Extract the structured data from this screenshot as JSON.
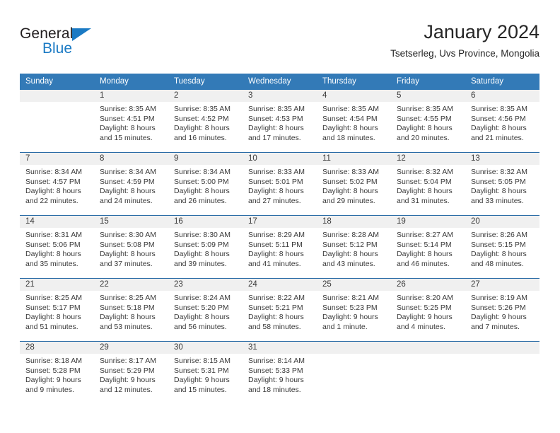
{
  "brand": {
    "name_part1": "General",
    "name_part2": "Blue",
    "accent_color": "#1a7ac4",
    "triangle_icon": "blue-triangle-icon"
  },
  "header": {
    "title": "January 2024",
    "subtitle": "Tsetserleg, Uvs Province, Mongolia"
  },
  "calendar": {
    "header_bg": "#337ab7",
    "header_text_color": "#ffffff",
    "row_separator_color": "#2a6ca6",
    "day_band_bg": "#f0f0f0",
    "weekdays": [
      "Sunday",
      "Monday",
      "Tuesday",
      "Wednesday",
      "Thursday",
      "Friday",
      "Saturday"
    ],
    "weeks": [
      [
        {
          "day": "",
          "sunrise": "",
          "sunset": "",
          "daylight_line1": "",
          "daylight_line2": "",
          "empty": true
        },
        {
          "day": "1",
          "sunrise": "Sunrise: 8:35 AM",
          "sunset": "Sunset: 4:51 PM",
          "daylight_line1": "Daylight: 8 hours",
          "daylight_line2": "and 15 minutes.",
          "empty": false
        },
        {
          "day": "2",
          "sunrise": "Sunrise: 8:35 AM",
          "sunset": "Sunset: 4:52 PM",
          "daylight_line1": "Daylight: 8 hours",
          "daylight_line2": "and 16 minutes.",
          "empty": false
        },
        {
          "day": "3",
          "sunrise": "Sunrise: 8:35 AM",
          "sunset": "Sunset: 4:53 PM",
          "daylight_line1": "Daylight: 8 hours",
          "daylight_line2": "and 17 minutes.",
          "empty": false
        },
        {
          "day": "4",
          "sunrise": "Sunrise: 8:35 AM",
          "sunset": "Sunset: 4:54 PM",
          "daylight_line1": "Daylight: 8 hours",
          "daylight_line2": "and 18 minutes.",
          "empty": false
        },
        {
          "day": "5",
          "sunrise": "Sunrise: 8:35 AM",
          "sunset": "Sunset: 4:55 PM",
          "daylight_line1": "Daylight: 8 hours",
          "daylight_line2": "and 20 minutes.",
          "empty": false
        },
        {
          "day": "6",
          "sunrise": "Sunrise: 8:35 AM",
          "sunset": "Sunset: 4:56 PM",
          "daylight_line1": "Daylight: 8 hours",
          "daylight_line2": "and 21 minutes.",
          "empty": false
        }
      ],
      [
        {
          "day": "7",
          "sunrise": "Sunrise: 8:34 AM",
          "sunset": "Sunset: 4:57 PM",
          "daylight_line1": "Daylight: 8 hours",
          "daylight_line2": "and 22 minutes.",
          "empty": false
        },
        {
          "day": "8",
          "sunrise": "Sunrise: 8:34 AM",
          "sunset": "Sunset: 4:59 PM",
          "daylight_line1": "Daylight: 8 hours",
          "daylight_line2": "and 24 minutes.",
          "empty": false
        },
        {
          "day": "9",
          "sunrise": "Sunrise: 8:34 AM",
          "sunset": "Sunset: 5:00 PM",
          "daylight_line1": "Daylight: 8 hours",
          "daylight_line2": "and 26 minutes.",
          "empty": false
        },
        {
          "day": "10",
          "sunrise": "Sunrise: 8:33 AM",
          "sunset": "Sunset: 5:01 PM",
          "daylight_line1": "Daylight: 8 hours",
          "daylight_line2": "and 27 minutes.",
          "empty": false
        },
        {
          "day": "11",
          "sunrise": "Sunrise: 8:33 AM",
          "sunset": "Sunset: 5:02 PM",
          "daylight_line1": "Daylight: 8 hours",
          "daylight_line2": "and 29 minutes.",
          "empty": false
        },
        {
          "day": "12",
          "sunrise": "Sunrise: 8:32 AM",
          "sunset": "Sunset: 5:04 PM",
          "daylight_line1": "Daylight: 8 hours",
          "daylight_line2": "and 31 minutes.",
          "empty": false
        },
        {
          "day": "13",
          "sunrise": "Sunrise: 8:32 AM",
          "sunset": "Sunset: 5:05 PM",
          "daylight_line1": "Daylight: 8 hours",
          "daylight_line2": "and 33 minutes.",
          "empty": false
        }
      ],
      [
        {
          "day": "14",
          "sunrise": "Sunrise: 8:31 AM",
          "sunset": "Sunset: 5:06 PM",
          "daylight_line1": "Daylight: 8 hours",
          "daylight_line2": "and 35 minutes.",
          "empty": false
        },
        {
          "day": "15",
          "sunrise": "Sunrise: 8:30 AM",
          "sunset": "Sunset: 5:08 PM",
          "daylight_line1": "Daylight: 8 hours",
          "daylight_line2": "and 37 minutes.",
          "empty": false
        },
        {
          "day": "16",
          "sunrise": "Sunrise: 8:30 AM",
          "sunset": "Sunset: 5:09 PM",
          "daylight_line1": "Daylight: 8 hours",
          "daylight_line2": "and 39 minutes.",
          "empty": false
        },
        {
          "day": "17",
          "sunrise": "Sunrise: 8:29 AM",
          "sunset": "Sunset: 5:11 PM",
          "daylight_line1": "Daylight: 8 hours",
          "daylight_line2": "and 41 minutes.",
          "empty": false
        },
        {
          "day": "18",
          "sunrise": "Sunrise: 8:28 AM",
          "sunset": "Sunset: 5:12 PM",
          "daylight_line1": "Daylight: 8 hours",
          "daylight_line2": "and 43 minutes.",
          "empty": false
        },
        {
          "day": "19",
          "sunrise": "Sunrise: 8:27 AM",
          "sunset": "Sunset: 5:14 PM",
          "daylight_line1": "Daylight: 8 hours",
          "daylight_line2": "and 46 minutes.",
          "empty": false
        },
        {
          "day": "20",
          "sunrise": "Sunrise: 8:26 AM",
          "sunset": "Sunset: 5:15 PM",
          "daylight_line1": "Daylight: 8 hours",
          "daylight_line2": "and 48 minutes.",
          "empty": false
        }
      ],
      [
        {
          "day": "21",
          "sunrise": "Sunrise: 8:25 AM",
          "sunset": "Sunset: 5:17 PM",
          "daylight_line1": "Daylight: 8 hours",
          "daylight_line2": "and 51 minutes.",
          "empty": false
        },
        {
          "day": "22",
          "sunrise": "Sunrise: 8:25 AM",
          "sunset": "Sunset: 5:18 PM",
          "daylight_line1": "Daylight: 8 hours",
          "daylight_line2": "and 53 minutes.",
          "empty": false
        },
        {
          "day": "23",
          "sunrise": "Sunrise: 8:24 AM",
          "sunset": "Sunset: 5:20 PM",
          "daylight_line1": "Daylight: 8 hours",
          "daylight_line2": "and 56 minutes.",
          "empty": false
        },
        {
          "day": "24",
          "sunrise": "Sunrise: 8:22 AM",
          "sunset": "Sunset: 5:21 PM",
          "daylight_line1": "Daylight: 8 hours",
          "daylight_line2": "and 58 minutes.",
          "empty": false
        },
        {
          "day": "25",
          "sunrise": "Sunrise: 8:21 AM",
          "sunset": "Sunset: 5:23 PM",
          "daylight_line1": "Daylight: 9 hours",
          "daylight_line2": "and 1 minute.",
          "empty": false
        },
        {
          "day": "26",
          "sunrise": "Sunrise: 8:20 AM",
          "sunset": "Sunset: 5:25 PM",
          "daylight_line1": "Daylight: 9 hours",
          "daylight_line2": "and 4 minutes.",
          "empty": false
        },
        {
          "day": "27",
          "sunrise": "Sunrise: 8:19 AM",
          "sunset": "Sunset: 5:26 PM",
          "daylight_line1": "Daylight: 9 hours",
          "daylight_line2": "and 7 minutes.",
          "empty": false
        }
      ],
      [
        {
          "day": "28",
          "sunrise": "Sunrise: 8:18 AM",
          "sunset": "Sunset: 5:28 PM",
          "daylight_line1": "Daylight: 9 hours",
          "daylight_line2": "and 9 minutes.",
          "empty": false
        },
        {
          "day": "29",
          "sunrise": "Sunrise: 8:17 AM",
          "sunset": "Sunset: 5:29 PM",
          "daylight_line1": "Daylight: 9 hours",
          "daylight_line2": "and 12 minutes.",
          "empty": false
        },
        {
          "day": "30",
          "sunrise": "Sunrise: 8:15 AM",
          "sunset": "Sunset: 5:31 PM",
          "daylight_line1": "Daylight: 9 hours",
          "daylight_line2": "and 15 minutes.",
          "empty": false
        },
        {
          "day": "31",
          "sunrise": "Sunrise: 8:14 AM",
          "sunset": "Sunset: 5:33 PM",
          "daylight_line1": "Daylight: 9 hours",
          "daylight_line2": "and 18 minutes.",
          "empty": false
        },
        {
          "day": "",
          "sunrise": "",
          "sunset": "",
          "daylight_line1": "",
          "daylight_line2": "",
          "empty": true
        },
        {
          "day": "",
          "sunrise": "",
          "sunset": "",
          "daylight_line1": "",
          "daylight_line2": "",
          "empty": true
        },
        {
          "day": "",
          "sunrise": "",
          "sunset": "",
          "daylight_line1": "",
          "daylight_line2": "",
          "empty": true
        }
      ]
    ]
  }
}
